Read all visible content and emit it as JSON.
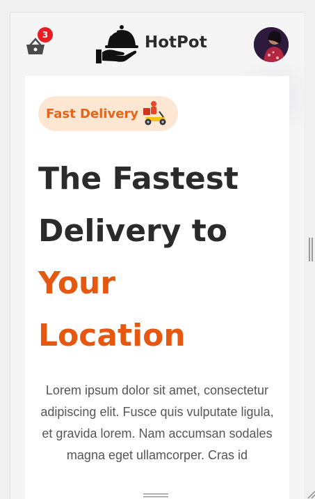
{
  "header": {
    "brand": "HotPot",
    "cart_count": "3",
    "icons": [
      "basket-icon",
      "serving-cloche-icon",
      "user-avatar"
    ]
  },
  "hero": {
    "chip_label": "Fast Delivery",
    "chip_icon": "delivery-scooter-icon",
    "headline_line1": "The Fastest",
    "headline_line2": "Delivery to",
    "headline_accent1": "Your",
    "headline_accent2": "Location",
    "description": "Lorem ipsum dolor sit amet, consectetur adipiscing elit. Fusce quis vulputate ligula, et gravida lorem. Nam accumsan sodales magna eget ullamcorper. Cras id"
  },
  "colors": {
    "accent": "#e6580f",
    "badge": "#ea1c24",
    "chip_bg": "#fde7d2",
    "text_dark": "#2b2b2b"
  }
}
